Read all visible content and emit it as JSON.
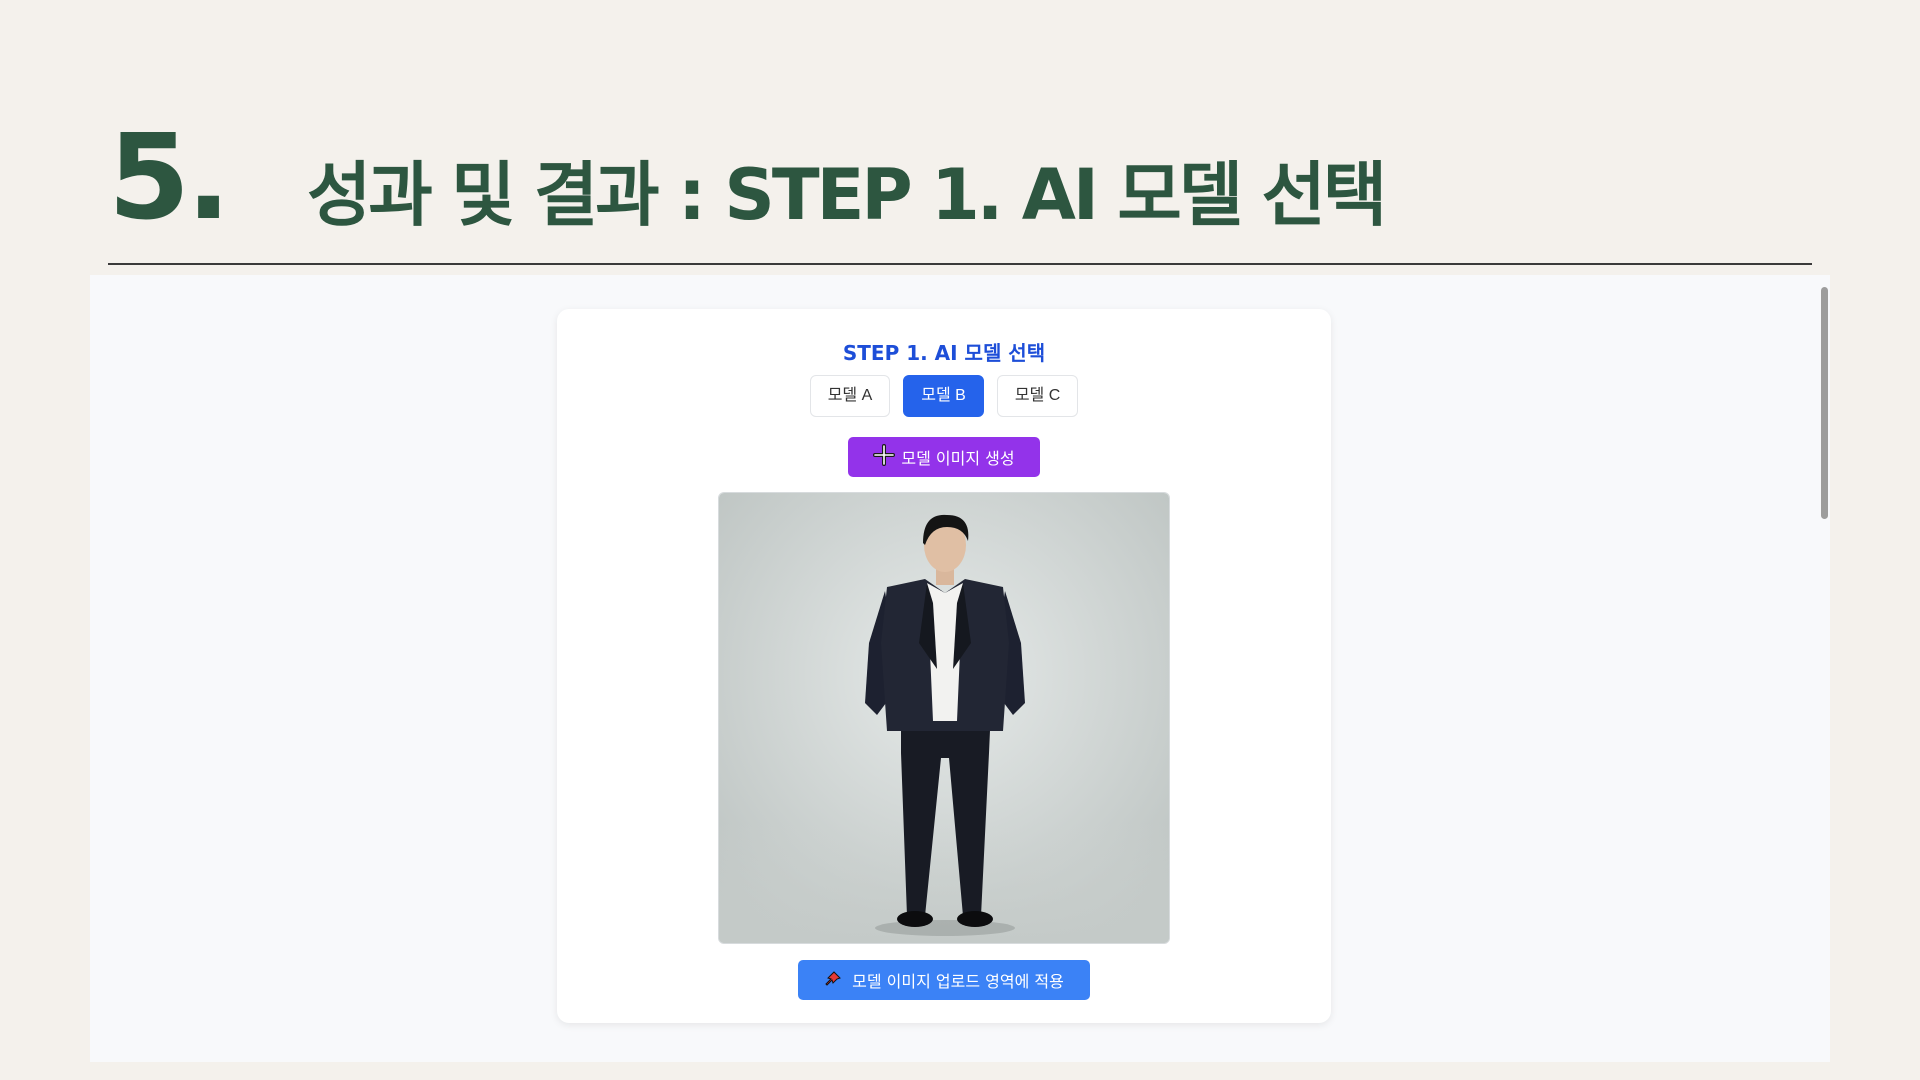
{
  "heading": {
    "number": "5.",
    "title": "성과 및 결과  : STEP 1. AI 모델 선택"
  },
  "card": {
    "title": "STEP 1. AI 모델 선택",
    "model_tabs": [
      {
        "label": "모델 A",
        "active": false
      },
      {
        "label": "모델 B",
        "active": true
      },
      {
        "label": "모델 C",
        "active": false
      }
    ],
    "generate_button": {
      "icon": "plus-icon",
      "label": "모델 이미지 생성"
    },
    "model_image": {
      "subject": "full-length photo of a man in a dark suit with white t-shirt on a light gray background"
    },
    "apply_button": {
      "icon": "pushpin-icon",
      "label": "모델 이미지 업로드 영역에 적용"
    }
  },
  "colors": {
    "heading": "#2d5640",
    "card_title": "#1d4ed8",
    "active_tab": "#2563eb",
    "generate_button": "#9333ea",
    "apply_button": "#3b82f6"
  }
}
